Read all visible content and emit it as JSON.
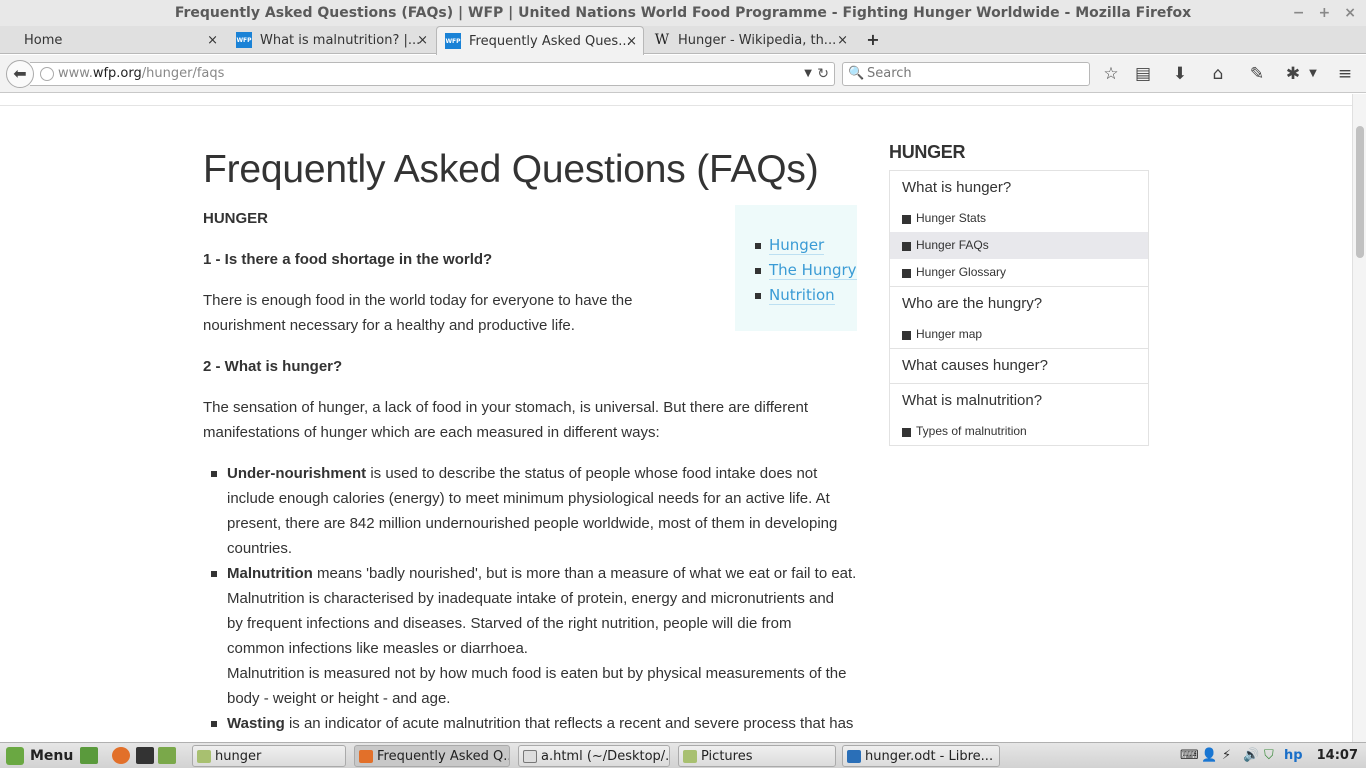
{
  "window": {
    "title": "Frequently Asked Questions (FAQs) | WFP | United Nations World Food Programme - Fighting Hunger Worldwide - Mozilla Firefox",
    "minimize": "−",
    "maximize": "+",
    "close": "×"
  },
  "tabs": [
    {
      "label": "Home",
      "favicon": "",
      "close": "×"
    },
    {
      "label": "What is malnutrition? |...",
      "favicon": "WFP",
      "close": "×"
    },
    {
      "label": "Frequently Asked Ques...",
      "favicon": "WFP",
      "close": "×",
      "active": true
    },
    {
      "label": "Hunger - Wikipedia, th...",
      "favicon": "W",
      "close": "×"
    }
  ],
  "new_tab": "+",
  "navbar": {
    "url_prefix": "www.",
    "url_host": "wfp.org",
    "url_path": "/hunger/faqs",
    "search_placeholder": "Search",
    "icons": [
      "back-icon",
      "bookmark-star-icon",
      "reading-list-icon",
      "download-icon",
      "home-icon",
      "sync-icon",
      "extension-icon",
      "hamburger-menu-icon"
    ]
  },
  "page": {
    "title": "Frequently Asked Questions (FAQs)",
    "section_heading": "HUNGER",
    "q1": "1 - Is there a food shortage in the world?",
    "a1_line1": "There is enough food in the world today for everyone to have the",
    "a1_line2": "nourishment necessary for a healthy and productive life.",
    "q2": "2 - What is hunger?",
    "a2_line1": "The sensation of hunger, a lack of food in your stomach, is universal. But there are different",
    "a2_line2": "manifestations of hunger which are each measured in different ways:",
    "bullets": [
      {
        "term": "Under-nourishment",
        "lines": [
          " is used to describe the status of people whose food intake does not",
          "include enough calories (energy) to meet minimum physiological needs for an active life. At",
          "present, there are 842 million undernourished people worldwide, most of them in developing",
          "countries."
        ]
      },
      {
        "term": "Malnutrition",
        "lines": [
          " means 'badly nourished', but is more than a measure of what we eat or fail to eat.",
          "Malnutrition is characterised by inadequate intake of protein, energy and micronutrients and",
          "by frequent infections and diseases. Starved of the right nutrition, people will die from",
          "common infections like measles or diarrhoea.",
          "Malnutrition is measured not by how much food is eaten but by physical measurements of the",
          "body - weight or height - and age."
        ]
      },
      {
        "term": "Wasting",
        "lines": [
          " is an indicator of acute malnutrition that reflects a recent and severe process that has"
        ]
      }
    ],
    "toc": [
      "Hunger",
      "The Hungry",
      "Nutrition"
    ]
  },
  "sidebar": {
    "heading": "HUNGER",
    "groups": [
      {
        "title": "What is hunger?",
        "items": [
          "Hunger Stats",
          "Hunger FAQs",
          "Hunger Glossary"
        ]
      },
      {
        "title": "Who are the hungry?",
        "items": [
          "Hunger map"
        ]
      },
      {
        "title": "What causes hunger?",
        "items": []
      },
      {
        "title": "What is malnutrition?",
        "items": [
          "Types of malnutrition"
        ]
      }
    ],
    "selected_item": "Hunger FAQs"
  },
  "taskbar": {
    "menu_label": "Menu",
    "windows": [
      "hunger",
      "Frequently Asked Q...",
      "a.html (~/Desktop/...",
      "Pictures",
      "hunger.odt - Libre..."
    ],
    "clock": "14:07"
  },
  "colors": {
    "link": "#3a9bd5",
    "toc_bg": "#eefafa",
    "selected_bg": "#e8e8ec",
    "wfp_blue": "#1a82d6"
  }
}
